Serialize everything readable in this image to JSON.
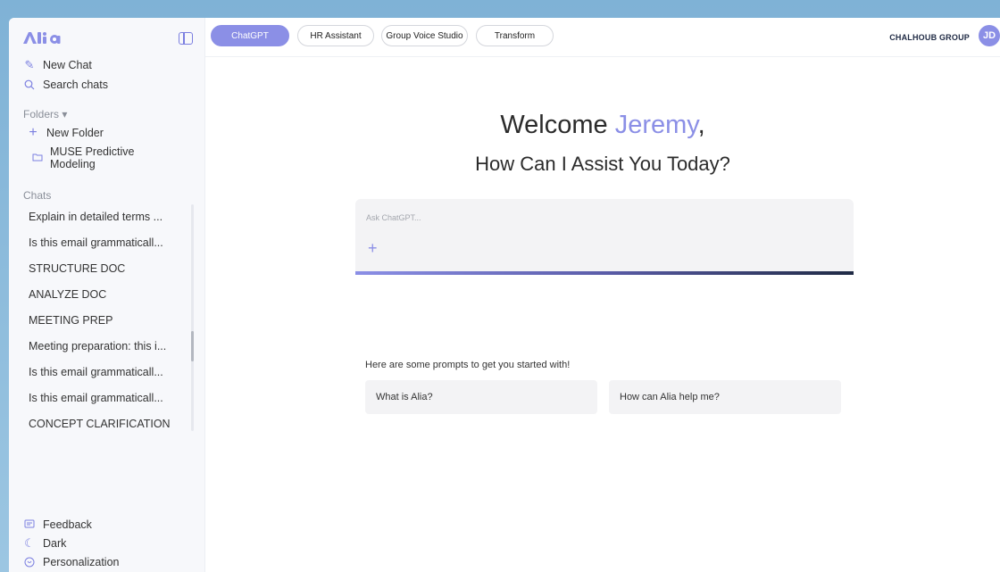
{
  "sidebar": {
    "logo_text": "Alia",
    "new_chat": "New Chat",
    "search_chats": "Search chats",
    "folders_label": "Folders ▾",
    "new_folder": "New Folder",
    "folder_items": [
      {
        "label_line1": "MUSE Predictive",
        "label_line2": "Modeling"
      }
    ],
    "chats_label": "Chats",
    "chats": [
      "Explain in detailed terms ...",
      "Is this email grammaticall...",
      "STRUCTURE DOC",
      "ANALYZE DOC",
      "MEETING PREP",
      "Meeting preparation: this i...",
      "Is this email grammaticall...",
      "Is this email grammaticall...",
      "CONCEPT CLARIFICATION"
    ],
    "footer": {
      "feedback": "Feedback",
      "dark": "Dark",
      "personalization": "Personalization"
    }
  },
  "topbar": {
    "tabs": [
      "ChatGPT",
      "HR Assistant",
      "Group Voice Studio",
      "Transform"
    ],
    "active_tab": "ChatGPT",
    "brand": "CHALHOUB GROUP",
    "avatar_initials": "JD"
  },
  "main": {
    "welcome_prefix": "Welcome ",
    "welcome_name": "Jeremy",
    "welcome_suffix": ",",
    "assist_text": "How Can I Assist You Today?",
    "input_placeholder": "Ask ChatGPT...",
    "prompts_label": "Here are some prompts to get you started with!",
    "prompts": [
      "What is Alia?",
      "How can Alia help me?"
    ]
  },
  "colors": {
    "accent": "#8b8fe6",
    "brand_dark": "#1f2a44"
  }
}
